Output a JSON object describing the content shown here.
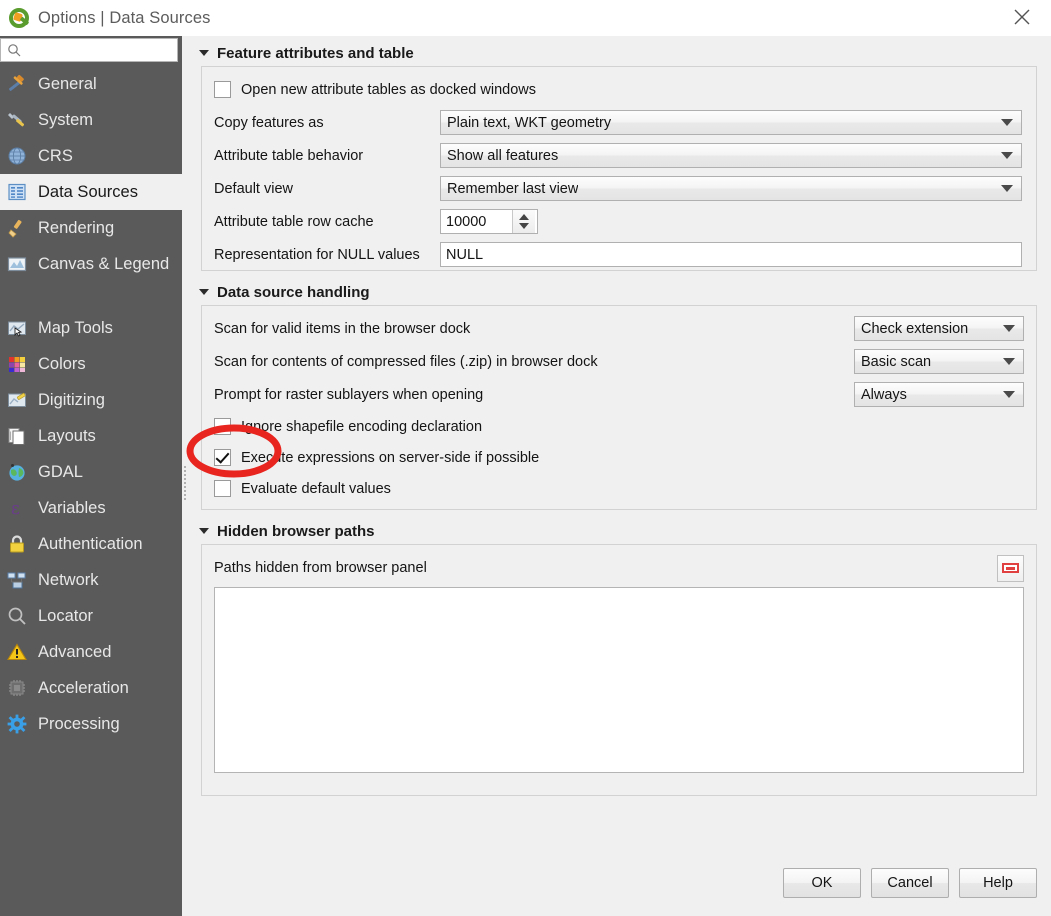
{
  "window": {
    "title": "Options | Data Sources",
    "close_label": "✕",
    "app_icon": "qgis-logo-icon"
  },
  "sidebar": {
    "search": {
      "value": "",
      "placeholder": "",
      "icon": "search-icon"
    },
    "items": [
      {
        "label": "General",
        "icon": "hammer-wrench-icon",
        "selected": false
      },
      {
        "label": "System",
        "icon": "wrench-pencil-icon",
        "selected": false
      },
      {
        "label": "CRS",
        "icon": "globe-grid-icon",
        "selected": false
      },
      {
        "label": "Data Sources",
        "icon": "table-grid-icon",
        "selected": true
      },
      {
        "label": "Rendering",
        "icon": "paintbrush-icon",
        "selected": false
      },
      {
        "label": "Canvas & Legend",
        "icon": "map-canvas-icon",
        "selected": false
      },
      {
        "label": "Map Tools",
        "icon": "map-cursor-icon",
        "selected": false
      },
      {
        "label": "Colors",
        "icon": "color-swatches-icon",
        "selected": false
      },
      {
        "label": "Digitizing",
        "icon": "pencil-edit-icon",
        "selected": false
      },
      {
        "label": "Layouts",
        "icon": "pages-icon",
        "selected": false
      },
      {
        "label": "GDAL",
        "icon": "globe-earth-icon",
        "selected": false
      },
      {
        "label": "Variables",
        "icon": "epsilon-icon",
        "selected": false
      },
      {
        "label": "Authentication",
        "icon": "padlock-icon",
        "selected": false
      },
      {
        "label": "Network",
        "icon": "network-computers-icon",
        "selected": false
      },
      {
        "label": "Locator",
        "icon": "magnifier-icon",
        "selected": false
      },
      {
        "label": "Advanced",
        "icon": "warning-triangle-icon",
        "selected": false
      },
      {
        "label": "Acceleration",
        "icon": "cpu-chip-icon",
        "selected": false
      },
      {
        "label": "Processing",
        "icon": "gear-icon",
        "selected": false
      }
    ]
  },
  "sections": {
    "feature_attributes": {
      "title": "Feature attributes and table",
      "docked_checkbox": {
        "label": "Open new attribute tables as docked windows",
        "checked": false
      },
      "copy_features_as": {
        "label": "Copy features as",
        "value": "Plain text, WKT geometry"
      },
      "attribute_table_behavior": {
        "label": "Attribute table behavior",
        "value": "Show all features"
      },
      "default_view": {
        "label": "Default view",
        "value": "Remember last view"
      },
      "row_cache": {
        "label": "Attribute table row cache",
        "value": "10000"
      },
      "null_representation": {
        "label": "Representation for NULL values",
        "value": "NULL"
      }
    },
    "data_source_handling": {
      "title": "Data source handling",
      "scan_valid_items": {
        "label": "Scan for valid items in the browser dock",
        "value": "Check extension"
      },
      "scan_compressed": {
        "label": "Scan for contents of compressed files (.zip) in browser dock",
        "value": "Basic scan"
      },
      "prompt_raster_sublayers": {
        "label": "Prompt for raster sublayers when opening",
        "value": "Always"
      },
      "ignore_shapefile_encoding": {
        "label": "Ignore shapefile encoding declaration",
        "checked": false
      },
      "execute_server_side": {
        "label": "Execute expressions on server-side if possible",
        "checked": true
      },
      "evaluate_defaults": {
        "label": "Evaluate default values",
        "checked": false
      }
    },
    "hidden_browser_paths": {
      "title": "Hidden browser paths",
      "paths_label": "Paths hidden from browser panel",
      "remove_button_icon": "remove-icon",
      "list_value": ""
    }
  },
  "footer": {
    "ok": "OK",
    "cancel": "Cancel",
    "help": "Help"
  },
  "annotation": {
    "shape": "ellipse",
    "color": "#e8251f",
    "target": "ignore-shapefile-encoding-checkbox"
  }
}
